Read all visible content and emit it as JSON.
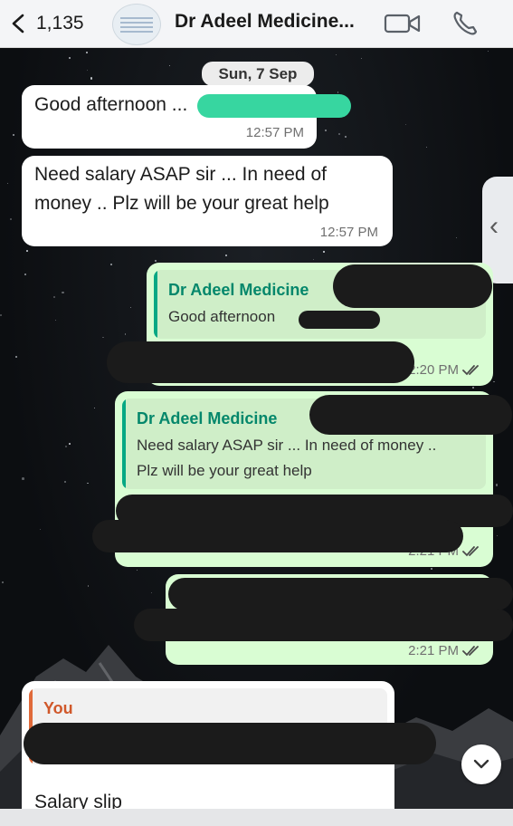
{
  "header": {
    "back_count": "1,135",
    "title": "Dr Adeel Medicine...",
    "icons": [
      "chevron-left-icon",
      "video-camera-icon",
      "phone-icon"
    ]
  },
  "date_label": "Sun, 7 Sep",
  "messages": [
    {
      "type": "incoming",
      "text": "Good afternoon ...",
      "time": "12:57 PM"
    },
    {
      "type": "incoming",
      "text_line1": "Need salary ASAP sir ... In need of",
      "text_line2": "money .. Plz will be your great help",
      "time": "12:57 PM"
    },
    {
      "type": "outgoing",
      "quote_name": "Dr Adeel Medicine",
      "quote_text": "Good afternoon",
      "time": "2:20 PM",
      "status": "read"
    },
    {
      "type": "outgoing",
      "quote_name": "Dr Adeel Medicine",
      "quote_line1": "Need salary ASAP sir ... In need of money ..",
      "quote_line2": "Plz will be your great help",
      "time": "2:21 PM",
      "status": "read"
    },
    {
      "type": "outgoing",
      "time": "2:21 PM",
      "status": "read"
    },
    {
      "type": "incoming",
      "quote_name": "You",
      "text": "Salary slip"
    }
  ],
  "colors": {
    "outgoing_bubble": "#d9fdd3",
    "quote_accent": "#06a884",
    "you_accent": "#e06a3a"
  }
}
